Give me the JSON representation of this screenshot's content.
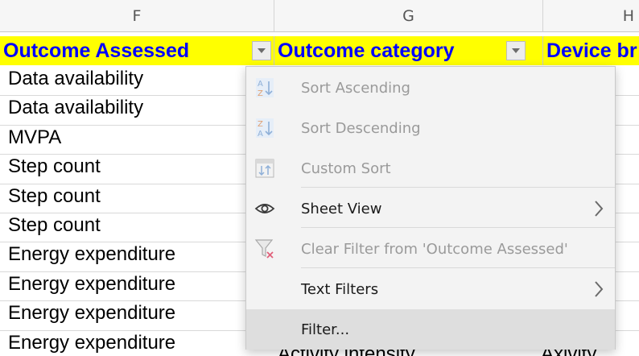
{
  "columns": [
    {
      "id": "F",
      "label": "F"
    },
    {
      "id": "G",
      "label": "G"
    },
    {
      "id": "H",
      "label": "H"
    }
  ],
  "header": {
    "colF": "Outcome Assessed",
    "colG": "Outcome category",
    "colH": "Device br"
  },
  "rows_f": [
    "Data availability",
    "Data availability",
    "MVPA",
    "Step count",
    "Step count",
    "Step count",
    "Energy expenditure",
    "Energy expenditure",
    "Energy expenditure",
    "Energy expenditure"
  ],
  "partial": {
    "g": "Activity intensity",
    "h": "Axivity"
  },
  "menu": {
    "items": [
      {
        "label": "Sort Ascending",
        "icon": "sort-ascending-icon",
        "enabled": false
      },
      {
        "label": "Sort Descending",
        "icon": "sort-descending-icon",
        "enabled": false
      },
      {
        "label": "Custom Sort",
        "icon": "custom-sort-icon",
        "enabled": false
      },
      {
        "label": "Sheet View",
        "icon": "eye-icon",
        "enabled": true,
        "submenu": true
      },
      {
        "label": "Clear Filter from 'Outcome Assessed'",
        "icon": "clear-filter-icon",
        "enabled": false
      },
      {
        "label": "Text Filters",
        "icon": "",
        "enabled": true,
        "submenu": true
      },
      {
        "label": "Filter...",
        "icon": "",
        "enabled": true,
        "highlighted": true
      }
    ]
  },
  "colors": {
    "header_bg": "#ffff00",
    "header_text": "#0000ff",
    "menu_bg": "#f3f3f3",
    "menu_hover": "#dedede"
  }
}
